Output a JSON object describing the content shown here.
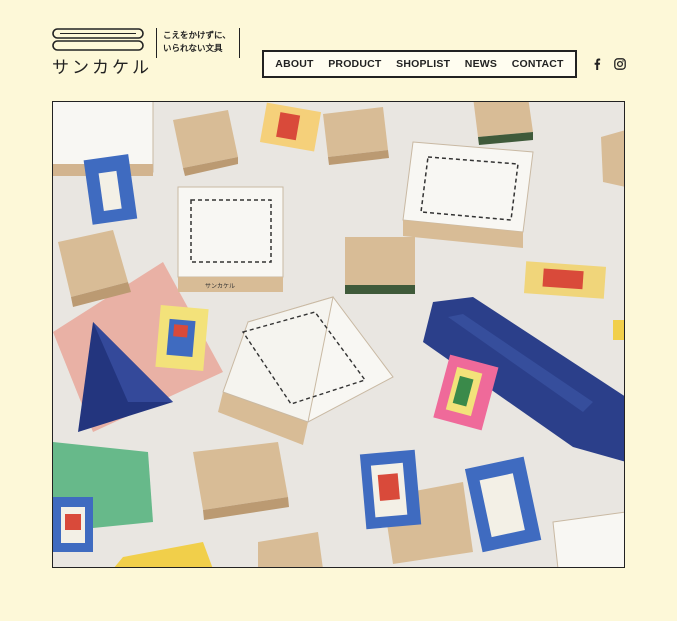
{
  "brand": {
    "name": "サンカケル",
    "tagline_line1": "こえをかけずに、",
    "tagline_line2": "いられない文具"
  },
  "nav": {
    "items": [
      {
        "label": "ABOUT"
      },
      {
        "label": "PRODUCT"
      },
      {
        "label": "SHOPLIST"
      },
      {
        "label": "NEWS"
      },
      {
        "label": "CONTACT"
      }
    ]
  },
  "social": {
    "facebook_icon": "facebook-icon",
    "instagram_icon": "instagram-icon"
  },
  "hero": {
    "stamp_label": "サンカケル"
  },
  "colors": {
    "background": "#fdf8d8",
    "text": "#222222",
    "photo_bg": "#e9e6e1"
  }
}
